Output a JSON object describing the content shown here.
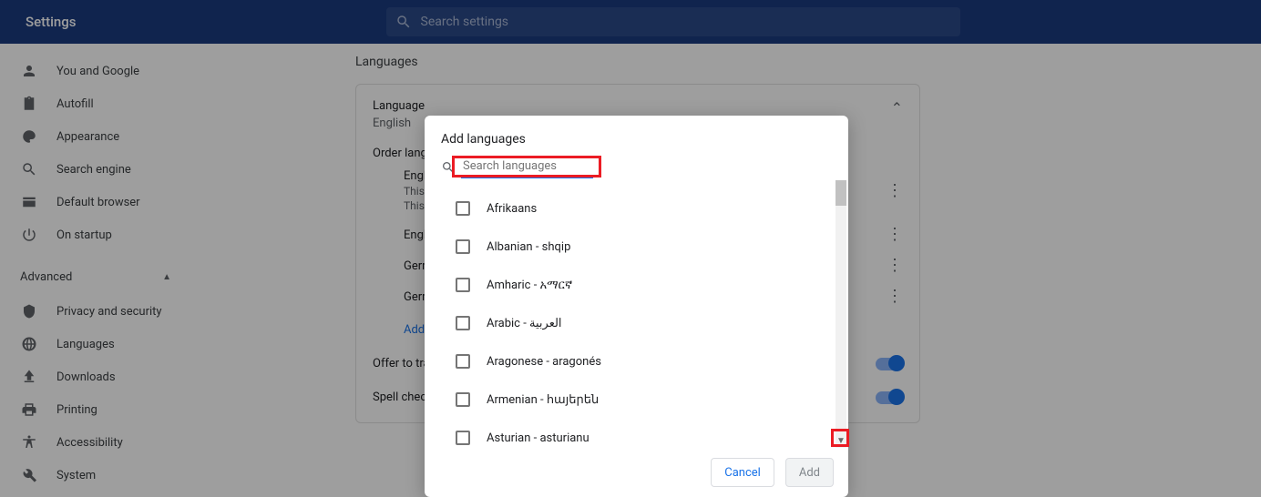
{
  "header": {
    "title": "Settings",
    "search_placeholder": "Search settings"
  },
  "sidebar": {
    "items": [
      {
        "icon": "person",
        "label": "You and Google"
      },
      {
        "icon": "clipboard",
        "label": "Autofill"
      },
      {
        "icon": "palette",
        "label": "Appearance"
      },
      {
        "icon": "search",
        "label": "Search engine"
      },
      {
        "icon": "browser",
        "label": "Default browser"
      },
      {
        "icon": "power",
        "label": "On startup"
      }
    ],
    "advanced_label": "Advanced",
    "advanced_items": [
      {
        "icon": "shield",
        "label": "Privacy and security"
      },
      {
        "icon": "globe",
        "label": "Languages"
      },
      {
        "icon": "download",
        "label": "Downloads"
      },
      {
        "icon": "printer",
        "label": "Printing"
      },
      {
        "icon": "accessibility",
        "label": "Accessibility"
      },
      {
        "icon": "wrench",
        "label": "System"
      }
    ]
  },
  "main": {
    "section_title": "Languages",
    "lang_label": "Language",
    "lang_value": "English",
    "order_label": "Order languages based on your preference",
    "entries": [
      {
        "name": "English (United States)",
        "sub1": "This language is used to display the Google Chrome UI",
        "sub2": "This language is used when translating pages"
      },
      {
        "name": "English"
      },
      {
        "name": "German"
      },
      {
        "name": "German (Germany)"
      }
    ],
    "add_label": "Add languages",
    "offer_label": "Offer to translate pages that aren't in a language you read",
    "spell_label": "Spell check"
  },
  "dialog": {
    "title": "Add languages",
    "search_placeholder": "Search languages",
    "options": [
      "Afrikaans",
      "Albanian - shqip",
      "Amharic - አማርኛ",
      "Arabic - العربية",
      "Aragonese - aragonés",
      "Armenian - հայերեն",
      "Asturian - asturianu"
    ],
    "cancel": "Cancel",
    "add": "Add"
  }
}
